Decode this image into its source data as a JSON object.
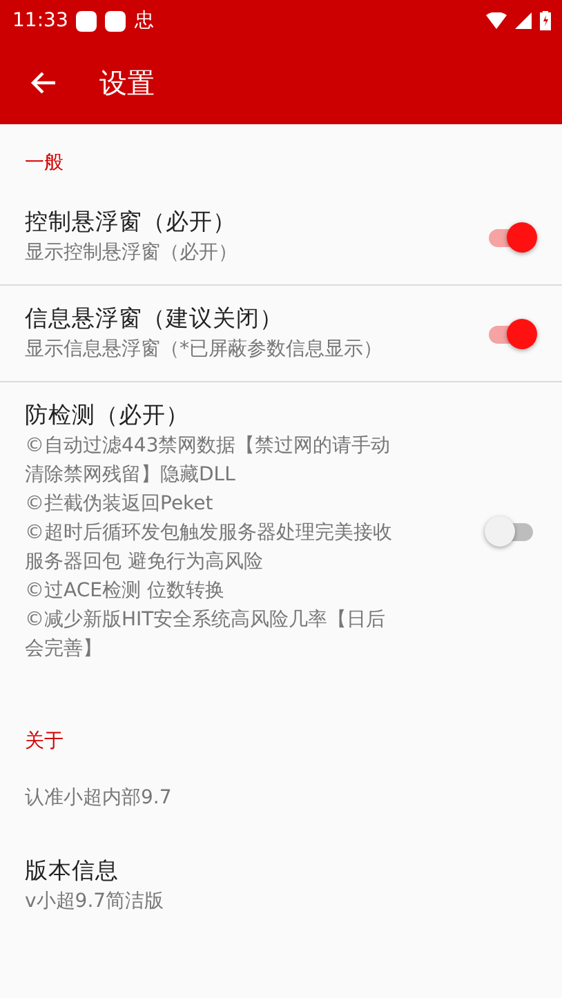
{
  "status_bar": {
    "time": "11:33",
    "notification_text": "忠"
  },
  "toolbar": {
    "title": "设置"
  },
  "sections": [
    {
      "header": "一般",
      "items": [
        {
          "kind": "switch",
          "title": "控制悬浮窗（必开）",
          "summary": "显示控制悬浮窗（必开）",
          "on": true
        },
        {
          "kind": "switch",
          "title": "信息悬浮窗（建议关闭）",
          "summary": "显示信息悬浮窗（*已屏蔽参数信息显示）",
          "on": true
        },
        {
          "kind": "switch",
          "title": "防检测（必开）",
          "summary": "©自动过滤443禁网数据【禁过网的请手动清除禁网残留】隐藏DLL\n©拦截伪装返回Peket\n©超时后循环发包触发服务器处理完美接收服务器回包 避免行为高风险\n©过ACE检测 位数转换\n©减少新版HIT安全系统高风险几率【日后会完善】",
          "on": false
        }
      ]
    },
    {
      "header": "关于",
      "items": [
        {
          "kind": "text",
          "summary": "认准小超内部9.7"
        },
        {
          "kind": "text",
          "title": "版本信息",
          "summary": "v小超9.7简洁版"
        }
      ]
    }
  ]
}
